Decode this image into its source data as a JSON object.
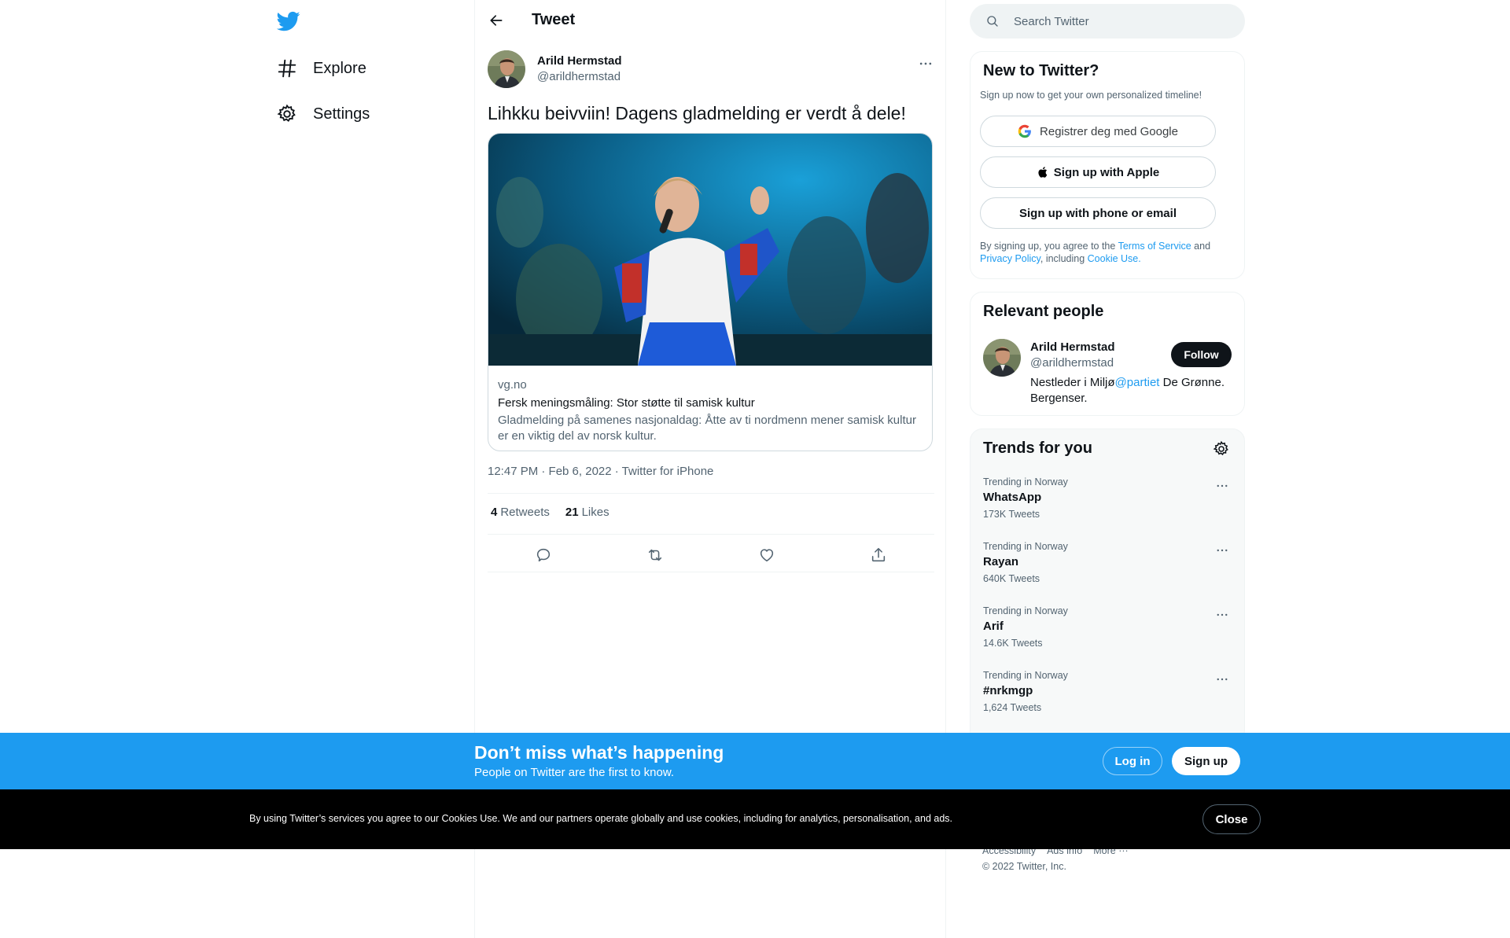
{
  "nav": {
    "logo_icon": "twitter-bird-icon",
    "items": [
      {
        "label": "Explore",
        "icon": "hashtag-icon"
      },
      {
        "label": "Settings",
        "icon": "gear-icon"
      }
    ]
  },
  "header": {
    "title": "Tweet"
  },
  "tweet": {
    "author_name": "Arild Hermstad",
    "author_handle": "@arildhermstad",
    "text": "Lihkku beivviin! Dagens gladmelding er verdt å dele!",
    "card": {
      "domain": "vg.no",
      "title": "Fersk meningsmåling: Stor støtte til samisk kultur",
      "description": "Gladmelding på samenes nasjonaldag: Åtte av ti nordmenn mener samisk kultur er en viktig del av norsk kultur."
    },
    "meta": "12:47 PM · Feb 6, 2022 · Twitter for iPhone",
    "retweets_count": "4",
    "retweets_label": "Retweets",
    "likes_count": "21",
    "likes_label": "Likes"
  },
  "search": {
    "placeholder": "Search Twitter"
  },
  "signup_panel": {
    "title": "New to Twitter?",
    "subtitle": "Sign up now to get your own personalized timeline!",
    "google_label": "Registrer deg med Google",
    "apple_label": "Sign up with Apple",
    "phone_label": "Sign up with phone or email",
    "legal_prefix": "By signing up, you agree to the ",
    "terms_link": "Terms of Service",
    "legal_and": " and ",
    "privacy_link": "Privacy Policy",
    "legal_including": ", including ",
    "cookie_link": "Cookie Use."
  },
  "relevant": {
    "title": "Relevant people",
    "name": "Arild Hermstad",
    "handle": "@arildhermstad",
    "follow_label": "Follow",
    "bio_prefix": "Nestleder i Miljø",
    "bio_link": "@partiet",
    "bio_suffix": " De Grønne. Bergenser."
  },
  "trends": {
    "title": "Trends for you",
    "items": [
      {
        "context": "Trending in Norway",
        "name": "WhatsApp",
        "count": "173K Tweets"
      },
      {
        "context": "Trending in Norway",
        "name": "Rayan",
        "count": "640K Tweets"
      },
      {
        "context": "Trending in Norway",
        "name": "Arif",
        "count": "14.6K Tweets"
      },
      {
        "context": "Trending in Norway",
        "name": "#nrkmgp",
        "count": "1,624 Tweets"
      }
    ]
  },
  "footer": {
    "links": [
      "Accessibility",
      "Ads info",
      "More ···"
    ],
    "copyright": "© 2022 Twitter, Inc."
  },
  "banner": {
    "title": "Don’t miss what’s happening",
    "subtitle": "People on Twitter are the first to know.",
    "login_label": "Log in",
    "signup_label": "Sign up"
  },
  "cookie": {
    "text": "By using Twitter’s services you agree to our Cookies Use. We and our partners operate globally and use cookies, including for analytics, personalisation, and ads.",
    "close_label": "Close"
  },
  "colors": {
    "brand_blue": "#1d9bf0",
    "text_primary": "#0f1419",
    "text_secondary": "#536471"
  }
}
